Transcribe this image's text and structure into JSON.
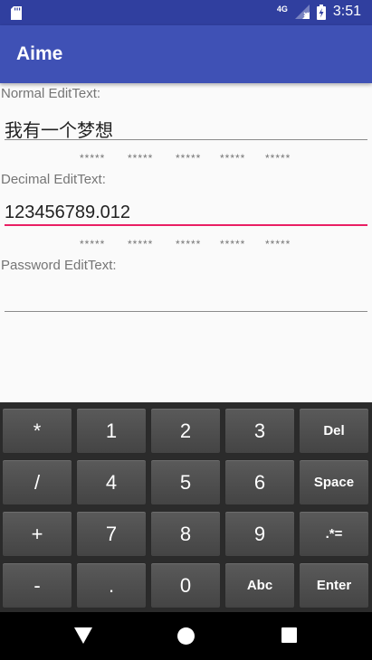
{
  "status": {
    "network": "4G",
    "time": "3:51"
  },
  "app": {
    "title": "Aime"
  },
  "fields": {
    "normal": {
      "label": "Normal EditText:",
      "value": "我有一个梦想"
    },
    "decimal": {
      "label": "Decimal EditText:",
      "value": "123456789.012"
    },
    "password": {
      "label": "Password EditText:",
      "value": ""
    }
  },
  "stars_row_1": [
    "*****",
    "*****",
    "*****",
    "*****",
    "*****"
  ],
  "stars_row_2": [
    "*****",
    "*****",
    "*****",
    "*****",
    "*****"
  ],
  "keypad": {
    "rows": [
      [
        "*",
        "1",
        "2",
        "3",
        "Del"
      ],
      [
        "/",
        "4",
        "5",
        "6",
        "Space"
      ],
      [
        "+",
        "7",
        "8",
        "9",
        ".*="
      ],
      [
        "-",
        ".",
        "0",
        "Abc",
        "Enter"
      ]
    ]
  },
  "colors": {
    "primary": "#3f51b5",
    "primary_dark": "#303f9f",
    "accent": "#e91e63",
    "keypad_bg": "#2b2b2b"
  },
  "icons": {
    "statusbar": [
      "sd-card-icon",
      "cell-signal-icon",
      "battery-charging-icon"
    ],
    "navbar": [
      "back-icon",
      "home-icon",
      "recents-icon"
    ]
  }
}
